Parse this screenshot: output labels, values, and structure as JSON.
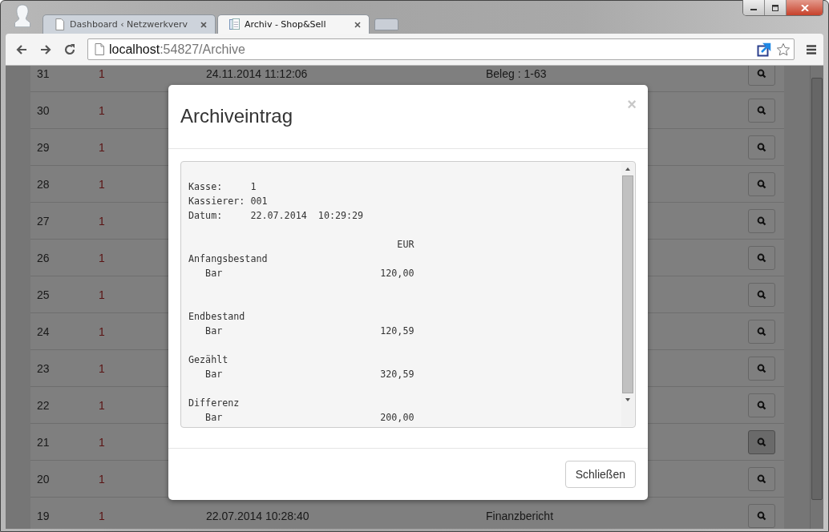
{
  "browser": {
    "tabs": [
      {
        "title": "Dashboard ‹ Netzwerkverv",
        "selected": false
      },
      {
        "title": "Archiv - Shop&Sell",
        "selected": true
      }
    ],
    "address": {
      "host": "localhost",
      "path": ":54827/Archive"
    }
  },
  "table": {
    "rows": [
      {
        "number": "31",
        "register": "1",
        "date": "24.11.2014 11:12:06",
        "document": "Beleg : 1-63",
        "pressed": false
      },
      {
        "number": "30",
        "register": "1",
        "pressed": false
      },
      {
        "number": "29",
        "register": "1",
        "pressed": false
      },
      {
        "number": "28",
        "register": "1",
        "pressed": false
      },
      {
        "number": "27",
        "register": "1",
        "pressed": false
      },
      {
        "number": "26",
        "register": "1",
        "pressed": false
      },
      {
        "number": "25",
        "register": "1",
        "pressed": false
      },
      {
        "number": "24",
        "register": "1",
        "pressed": false
      },
      {
        "number": "23",
        "register": "1",
        "pressed": false
      },
      {
        "number": "22",
        "register": "1",
        "pressed": false
      },
      {
        "number": "21",
        "register": "1",
        "pressed": true
      },
      {
        "number": "20",
        "register": "1",
        "pressed": false
      },
      {
        "number": "19",
        "register": "1",
        "date": "22.07.2014 10:28:40",
        "document": "Finanzbericht",
        "pressed": false
      }
    ]
  },
  "modal": {
    "title": "Archiveintrag",
    "close": "×",
    "receipt": "Kasse:     1\nKassierer: 001\nDatum:     22.07.2014  10:29:29\n\n                                     EUR\nAnfangsbestand\n   Bar                            120,00\n\n\nEndbestand\n   Bar                            120,59\n\nGezählt\n   Bar                            320,59\n\nDifferenz\n   Bar                            200,00",
    "buttons": [
      "Schließen"
    ]
  }
}
